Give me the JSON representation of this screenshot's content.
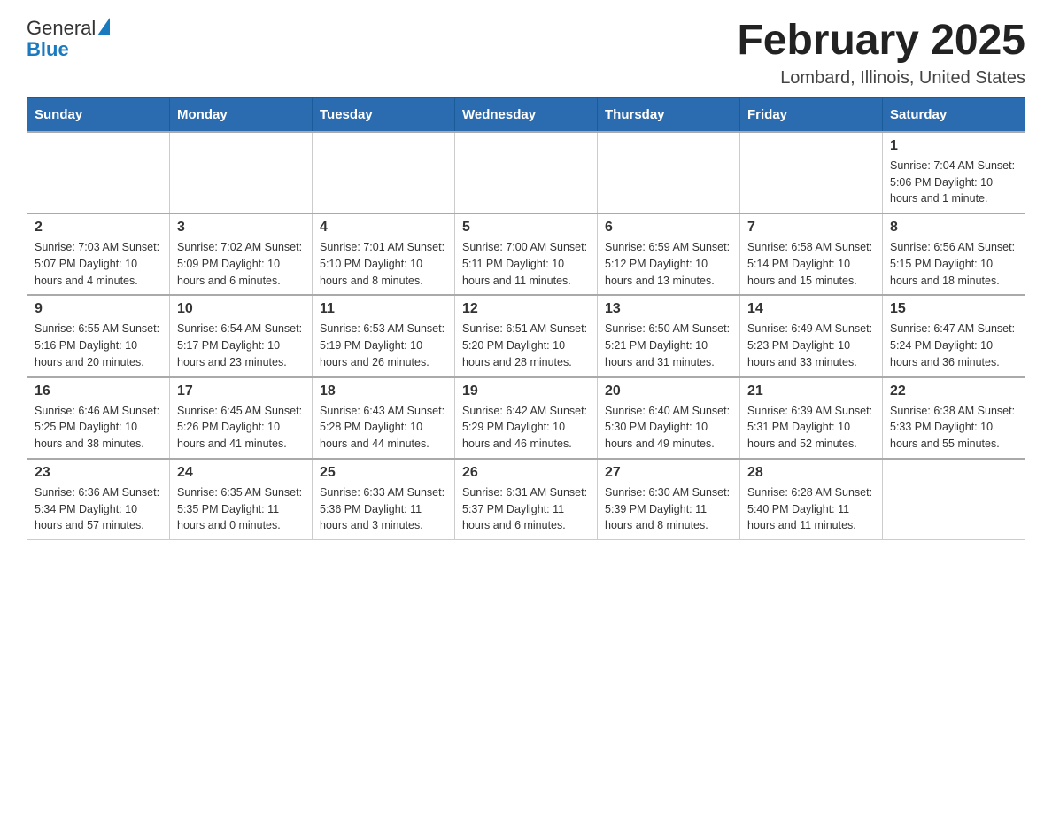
{
  "header": {
    "logo": {
      "general": "General",
      "blue": "Blue"
    },
    "month_title": "February 2025",
    "location": "Lombard, Illinois, United States"
  },
  "days_of_week": [
    "Sunday",
    "Monday",
    "Tuesday",
    "Wednesday",
    "Thursday",
    "Friday",
    "Saturday"
  ],
  "weeks": [
    [
      {
        "day": "",
        "info": ""
      },
      {
        "day": "",
        "info": ""
      },
      {
        "day": "",
        "info": ""
      },
      {
        "day": "",
        "info": ""
      },
      {
        "day": "",
        "info": ""
      },
      {
        "day": "",
        "info": ""
      },
      {
        "day": "1",
        "info": "Sunrise: 7:04 AM\nSunset: 5:06 PM\nDaylight: 10 hours and 1 minute."
      }
    ],
    [
      {
        "day": "2",
        "info": "Sunrise: 7:03 AM\nSunset: 5:07 PM\nDaylight: 10 hours and 4 minutes."
      },
      {
        "day": "3",
        "info": "Sunrise: 7:02 AM\nSunset: 5:09 PM\nDaylight: 10 hours and 6 minutes."
      },
      {
        "day": "4",
        "info": "Sunrise: 7:01 AM\nSunset: 5:10 PM\nDaylight: 10 hours and 8 minutes."
      },
      {
        "day": "5",
        "info": "Sunrise: 7:00 AM\nSunset: 5:11 PM\nDaylight: 10 hours and 11 minutes."
      },
      {
        "day": "6",
        "info": "Sunrise: 6:59 AM\nSunset: 5:12 PM\nDaylight: 10 hours and 13 minutes."
      },
      {
        "day": "7",
        "info": "Sunrise: 6:58 AM\nSunset: 5:14 PM\nDaylight: 10 hours and 15 minutes."
      },
      {
        "day": "8",
        "info": "Sunrise: 6:56 AM\nSunset: 5:15 PM\nDaylight: 10 hours and 18 minutes."
      }
    ],
    [
      {
        "day": "9",
        "info": "Sunrise: 6:55 AM\nSunset: 5:16 PM\nDaylight: 10 hours and 20 minutes."
      },
      {
        "day": "10",
        "info": "Sunrise: 6:54 AM\nSunset: 5:17 PM\nDaylight: 10 hours and 23 minutes."
      },
      {
        "day": "11",
        "info": "Sunrise: 6:53 AM\nSunset: 5:19 PM\nDaylight: 10 hours and 26 minutes."
      },
      {
        "day": "12",
        "info": "Sunrise: 6:51 AM\nSunset: 5:20 PM\nDaylight: 10 hours and 28 minutes."
      },
      {
        "day": "13",
        "info": "Sunrise: 6:50 AM\nSunset: 5:21 PM\nDaylight: 10 hours and 31 minutes."
      },
      {
        "day": "14",
        "info": "Sunrise: 6:49 AM\nSunset: 5:23 PM\nDaylight: 10 hours and 33 minutes."
      },
      {
        "day": "15",
        "info": "Sunrise: 6:47 AM\nSunset: 5:24 PM\nDaylight: 10 hours and 36 minutes."
      }
    ],
    [
      {
        "day": "16",
        "info": "Sunrise: 6:46 AM\nSunset: 5:25 PM\nDaylight: 10 hours and 38 minutes."
      },
      {
        "day": "17",
        "info": "Sunrise: 6:45 AM\nSunset: 5:26 PM\nDaylight: 10 hours and 41 minutes."
      },
      {
        "day": "18",
        "info": "Sunrise: 6:43 AM\nSunset: 5:28 PM\nDaylight: 10 hours and 44 minutes."
      },
      {
        "day": "19",
        "info": "Sunrise: 6:42 AM\nSunset: 5:29 PM\nDaylight: 10 hours and 46 minutes."
      },
      {
        "day": "20",
        "info": "Sunrise: 6:40 AM\nSunset: 5:30 PM\nDaylight: 10 hours and 49 minutes."
      },
      {
        "day": "21",
        "info": "Sunrise: 6:39 AM\nSunset: 5:31 PM\nDaylight: 10 hours and 52 minutes."
      },
      {
        "day": "22",
        "info": "Sunrise: 6:38 AM\nSunset: 5:33 PM\nDaylight: 10 hours and 55 minutes."
      }
    ],
    [
      {
        "day": "23",
        "info": "Sunrise: 6:36 AM\nSunset: 5:34 PM\nDaylight: 10 hours and 57 minutes."
      },
      {
        "day": "24",
        "info": "Sunrise: 6:35 AM\nSunset: 5:35 PM\nDaylight: 11 hours and 0 minutes."
      },
      {
        "day": "25",
        "info": "Sunrise: 6:33 AM\nSunset: 5:36 PM\nDaylight: 11 hours and 3 minutes."
      },
      {
        "day": "26",
        "info": "Sunrise: 6:31 AM\nSunset: 5:37 PM\nDaylight: 11 hours and 6 minutes."
      },
      {
        "day": "27",
        "info": "Sunrise: 6:30 AM\nSunset: 5:39 PM\nDaylight: 11 hours and 8 minutes."
      },
      {
        "day": "28",
        "info": "Sunrise: 6:28 AM\nSunset: 5:40 PM\nDaylight: 11 hours and 11 minutes."
      },
      {
        "day": "",
        "info": ""
      }
    ]
  ]
}
